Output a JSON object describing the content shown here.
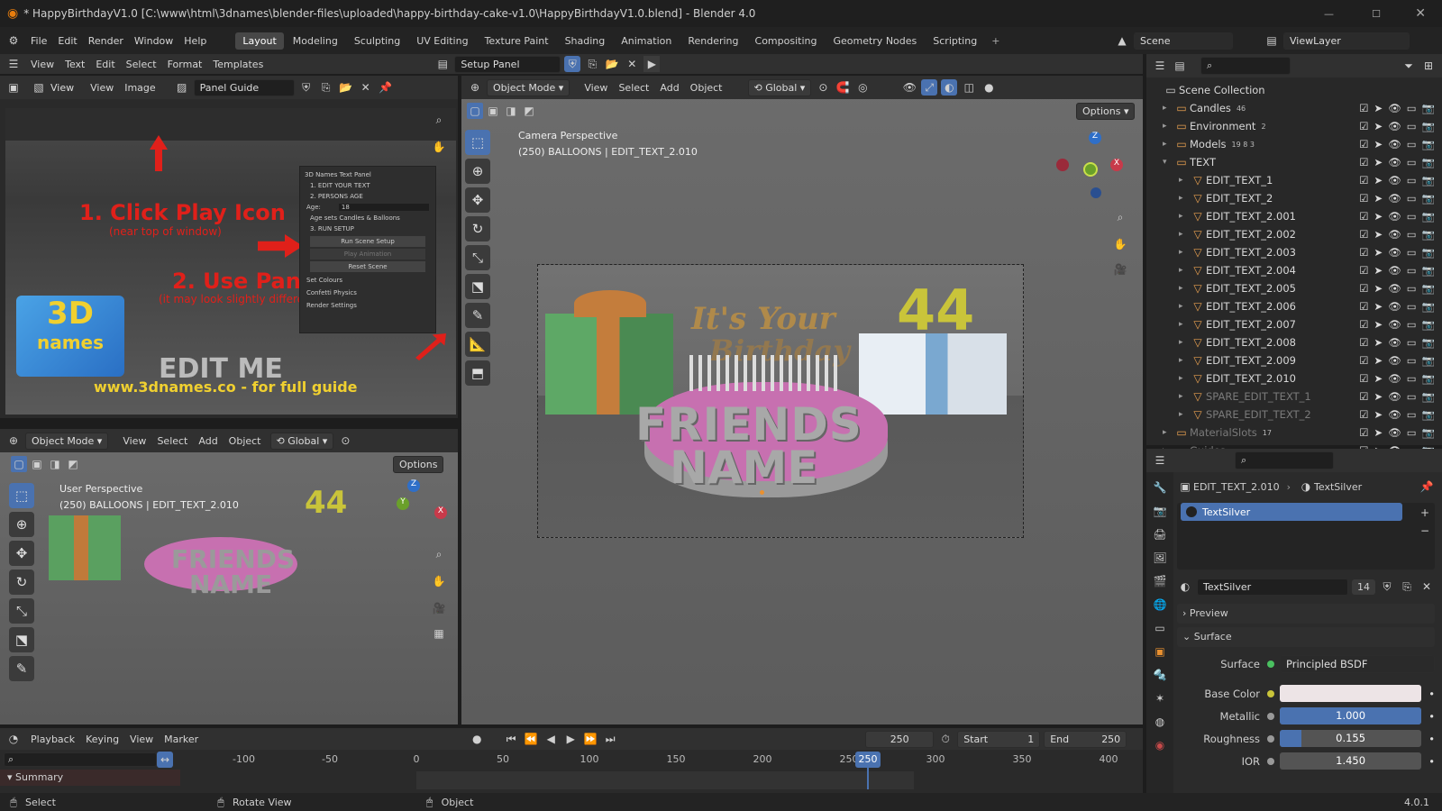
{
  "titlebar": {
    "title": "* HappyBirthdayV1.0 [C:\\www\\html\\3dnames\\blender-files\\uploaded\\happy-birthday-cake-v1.0\\HappyBirthdayV1.0.blend] - Blender 4.0"
  },
  "menubar": {
    "items": [
      "File",
      "Edit",
      "Render",
      "Window",
      "Help"
    ],
    "workspaces": [
      "Layout",
      "Modeling",
      "Sculpting",
      "UV Editing",
      "Texture Paint",
      "Shading",
      "Animation",
      "Rendering",
      "Compositing",
      "Geometry Nodes",
      "Scripting"
    ],
    "active_workspace": "Layout",
    "scene": "Scene",
    "view_layer": "ViewLayer"
  },
  "text_editor": {
    "menus": [
      "View",
      "Text",
      "Edit",
      "Select",
      "Format",
      "Templates"
    ],
    "file": "Setup Panel"
  },
  "image_editor": {
    "view_label": "View",
    "menus": [
      "View",
      "Image"
    ],
    "image": "Panel Guide",
    "guide": {
      "step1": "1. Click Play Icon",
      "step1_sub": "(near top of window)",
      "step2": "2. Use Panel",
      "step2_sub": "(it may look slightly different)",
      "logo1": "3D",
      "logo2": "names",
      "url": "www.3dnames.co - for full guide",
      "edit_me": "EDIT ME",
      "panel": {
        "title": "3D Names Text Panel",
        "i1": "1. EDIT YOUR TEXT",
        "i2": "2. PERSONS AGE",
        "age_label": "Age:",
        "age_value": "18",
        "note": "Age sets Candles & Balloons",
        "i3": "3. RUN SETUP",
        "b1": "Run Scene Setup",
        "b2": "Play Animation",
        "b3": "Reset Scene",
        "s1": "Set Colours",
        "s2": "Confetti Physics",
        "s3": "Render Settings"
      }
    }
  },
  "viewport_small": {
    "mode": "Object Mode",
    "menus": [
      "View",
      "Select",
      "Add",
      "Object"
    ],
    "orient": "Global",
    "options": "Options",
    "persp": "User Perspective",
    "info": "(250) BALLOONS | EDIT_TEXT_2.010"
  },
  "viewport_main": {
    "mode": "Object Mode",
    "menus": [
      "View",
      "Select",
      "Add",
      "Object"
    ],
    "orient": "Global",
    "options": "Options",
    "persp": "Camera Perspective",
    "info": "(250) BALLOONS | EDIT_TEXT_2.010"
  },
  "scene_text": {
    "line1": "It's Your",
    "line2": "Birthday",
    "age": "44",
    "name1": "FRIENDS",
    "name2": "NAME"
  },
  "outliner": {
    "root": "Scene Collection",
    "collections": [
      {
        "name": "Candles",
        "badge": "46"
      },
      {
        "name": "Environment",
        "badge": "2"
      },
      {
        "name": "Models",
        "badge": "19 8 3"
      },
      {
        "name": "TEXT",
        "badge": ""
      }
    ],
    "items": [
      "EDIT_TEXT_1",
      "EDIT_TEXT_2",
      "EDIT_TEXT_2.001",
      "EDIT_TEXT_2.002",
      "EDIT_TEXT_2.003",
      "EDIT_TEXT_2.004",
      "EDIT_TEXT_2.005",
      "EDIT_TEXT_2.006",
      "EDIT_TEXT_2.007",
      "EDIT_TEXT_2.008",
      "EDIT_TEXT_2.009",
      "EDIT_TEXT_2.010"
    ],
    "spare": [
      "SPARE_EDIT_TEXT_1",
      "SPARE_EDIT_TEXT_2"
    ],
    "after": [
      {
        "name": "MaterialSlots",
        "badge": "17"
      },
      {
        "name": "Guides",
        "badge": ""
      }
    ]
  },
  "properties": {
    "object": "EDIT_TEXT_2.010",
    "material": "TextSilver",
    "slot": "TextSilver",
    "mat_field": "TextSilver",
    "users": "14",
    "preview": "Preview",
    "surface_panel": "Surface",
    "surface_label": "Surface",
    "shader": "Principled BSDF",
    "rows": [
      {
        "label": "Base Color",
        "value": ""
      },
      {
        "label": "Metallic",
        "value": "1.000",
        "fill": 1.0
      },
      {
        "label": "Roughness",
        "value": "0.155",
        "fill": 0.155
      },
      {
        "label": "IOR",
        "value": "1.450",
        "fill": 0
      }
    ]
  },
  "timeline": {
    "menus": [
      "Playback",
      "Keying",
      "View",
      "Marker"
    ],
    "current": "250",
    "start_label": "Start",
    "start": "1",
    "end_label": "End",
    "end": "250",
    "ticks": [
      "-100",
      "-50",
      "0",
      "50",
      "100",
      "150",
      "200",
      "250",
      "300",
      "350",
      "400"
    ],
    "summary": "Summary"
  },
  "status": {
    "select": "Select",
    "rotate": "Rotate View",
    "object": "Object",
    "version": "4.0.1"
  }
}
